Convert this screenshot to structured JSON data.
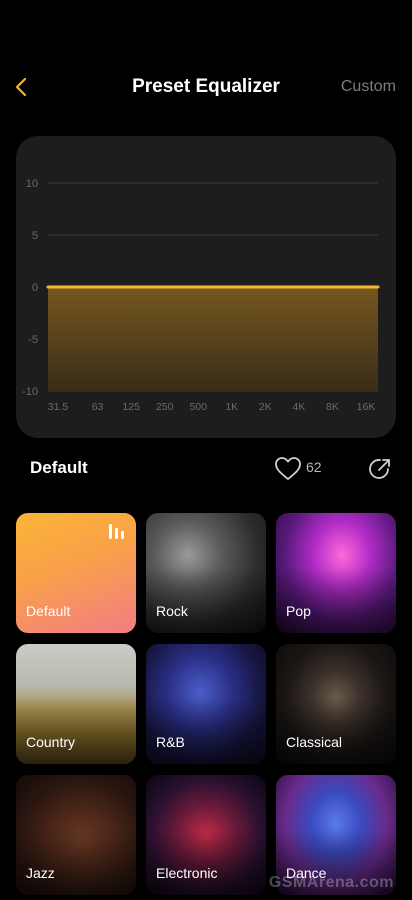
{
  "header": {
    "title": "Preset Equalizer",
    "custom_label": "Custom"
  },
  "chart_data": {
    "type": "line",
    "x": [
      "31.5",
      "63",
      "125",
      "250",
      "500",
      "1K",
      "2K",
      "4K",
      "8K",
      "16K"
    ],
    "series": [
      {
        "values": [
          0,
          0,
          0,
          0,
          0,
          0,
          0,
          0,
          0,
          0
        ]
      }
    ],
    "y_ticks": [
      "10",
      "5",
      "0",
      "-5",
      "-10"
    ],
    "ylim": [
      -10,
      10
    ],
    "grid": true,
    "line_color": "#f5b731"
  },
  "preset": {
    "name": "Default",
    "likes": "62"
  },
  "presets": [
    {
      "label": "Default",
      "selected": true
    },
    {
      "label": "Rock"
    },
    {
      "label": "Pop"
    },
    {
      "label": "Country"
    },
    {
      "label": "R&B"
    },
    {
      "label": "Classical"
    },
    {
      "label": "Jazz"
    },
    {
      "label": "Electronic"
    },
    {
      "label": "Dance"
    }
  ],
  "watermark": "GSMArena.com",
  "colors": {
    "accent": "#f5b731",
    "selected_tile_top": "#fcb536",
    "selected_tile_bottom": "#f37c86"
  }
}
